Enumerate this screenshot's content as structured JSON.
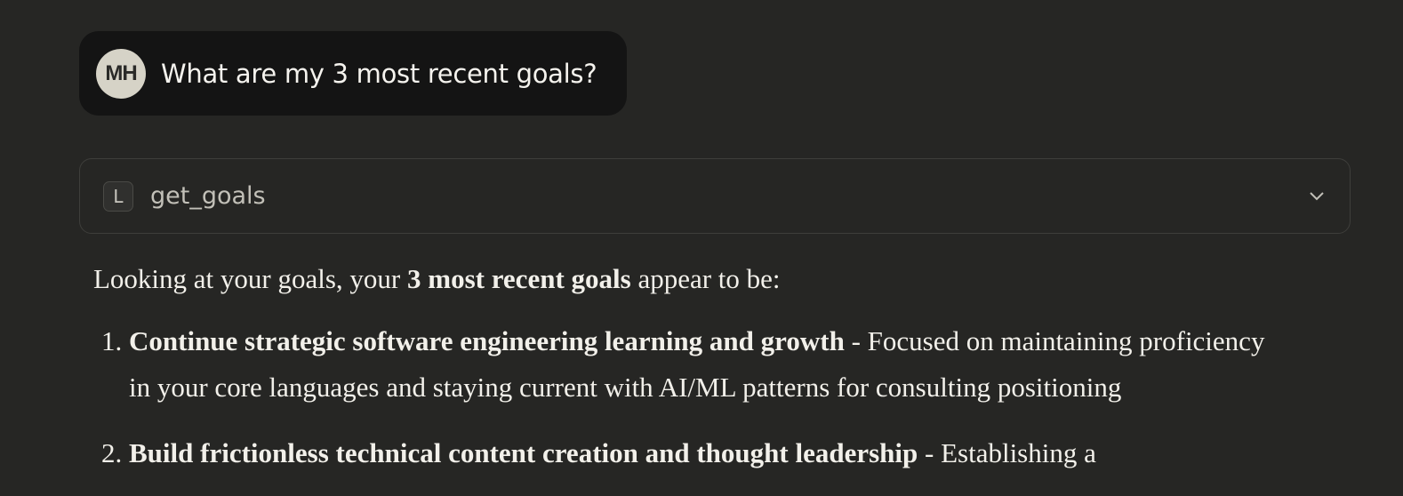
{
  "user_message": {
    "avatar_initials": "MH",
    "text": "What are my 3 most recent goals?"
  },
  "tool_call": {
    "icon_letter": "L",
    "name": "get_goals",
    "icon": "chevron-down-icon"
  },
  "answer": {
    "intro_prefix": "Looking at your goals, your ",
    "intro_bold": "3 most recent goals",
    "intro_suffix": " appear to be:",
    "goals": [
      {
        "title": "Continue strategic software engineering learning and growth",
        "description": " - Focused on maintaining proficiency in your core languages and staying current with AI/ML patterns for consulting positioning"
      },
      {
        "title": "Build frictionless technical content creation and thought leadership",
        "description": " - Establishing a"
      }
    ]
  }
}
